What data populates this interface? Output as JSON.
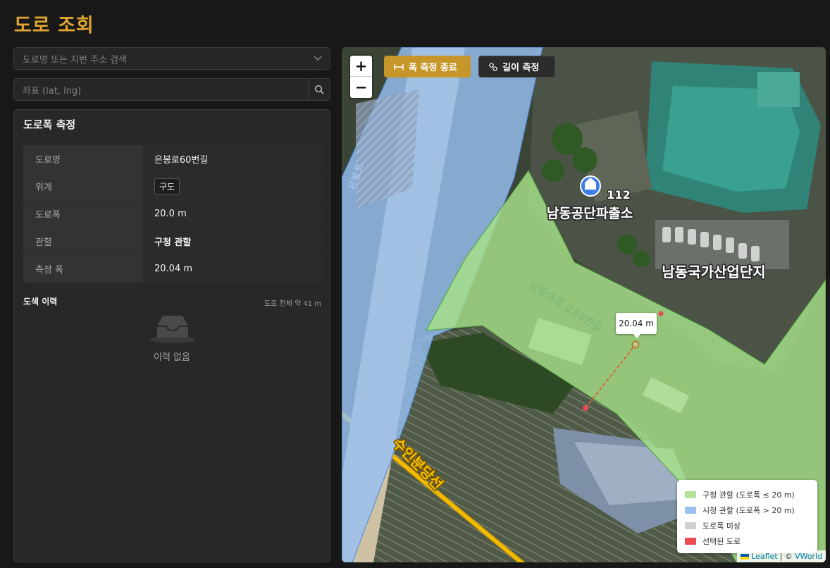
{
  "app": {
    "title": "도로 조회"
  },
  "search": {
    "placeholder": "도로명 또는 지번 주소 검색"
  },
  "coord": {
    "placeholder": "좌표 (lat, lng)"
  },
  "panel": {
    "title": "도로폭 측정",
    "rows": [
      {
        "label": "도로명",
        "value": "은봉로60번길"
      },
      {
        "label": "위계",
        "value": "구도"
      },
      {
        "label": "도로폭",
        "value": "20.0 m"
      },
      {
        "label": "관할",
        "value": "구청 관할"
      },
      {
        "label": "측정 폭",
        "value": "20.04 m"
      }
    ],
    "history": {
      "title": "도색 이력",
      "total": "도로 전체 약 41 m",
      "empty": "이력 없음"
    }
  },
  "map": {
    "zoom_in": "+",
    "zoom_out": "−",
    "width_button": "폭 측정 종료",
    "length_button": "길이 측정",
    "tooltip": "20.04 m",
    "labels": {
      "police_number": "112",
      "police": "남동공단파출소",
      "industrial": "남동국가산업단지",
      "road": "남동대로 239번길",
      "road2": "은봉로",
      "rail": "수인분당선"
    },
    "legend": [
      {
        "label": "구청 관할 (도로폭 ≤ 20 m)",
        "color": "#b6e39b"
      },
      {
        "label": "시청 관할 (도로폭 > 20 m)",
        "color": "#99c1f2"
      },
      {
        "label": "도로폭 미상",
        "color": "#cfcfcf"
      },
      {
        "label": "선택된 도로",
        "color": "#ec4b55"
      }
    ],
    "attribution": {
      "leaflet": "Leaflet",
      "sep": "| ©",
      "vworld": "VWorld"
    }
  }
}
